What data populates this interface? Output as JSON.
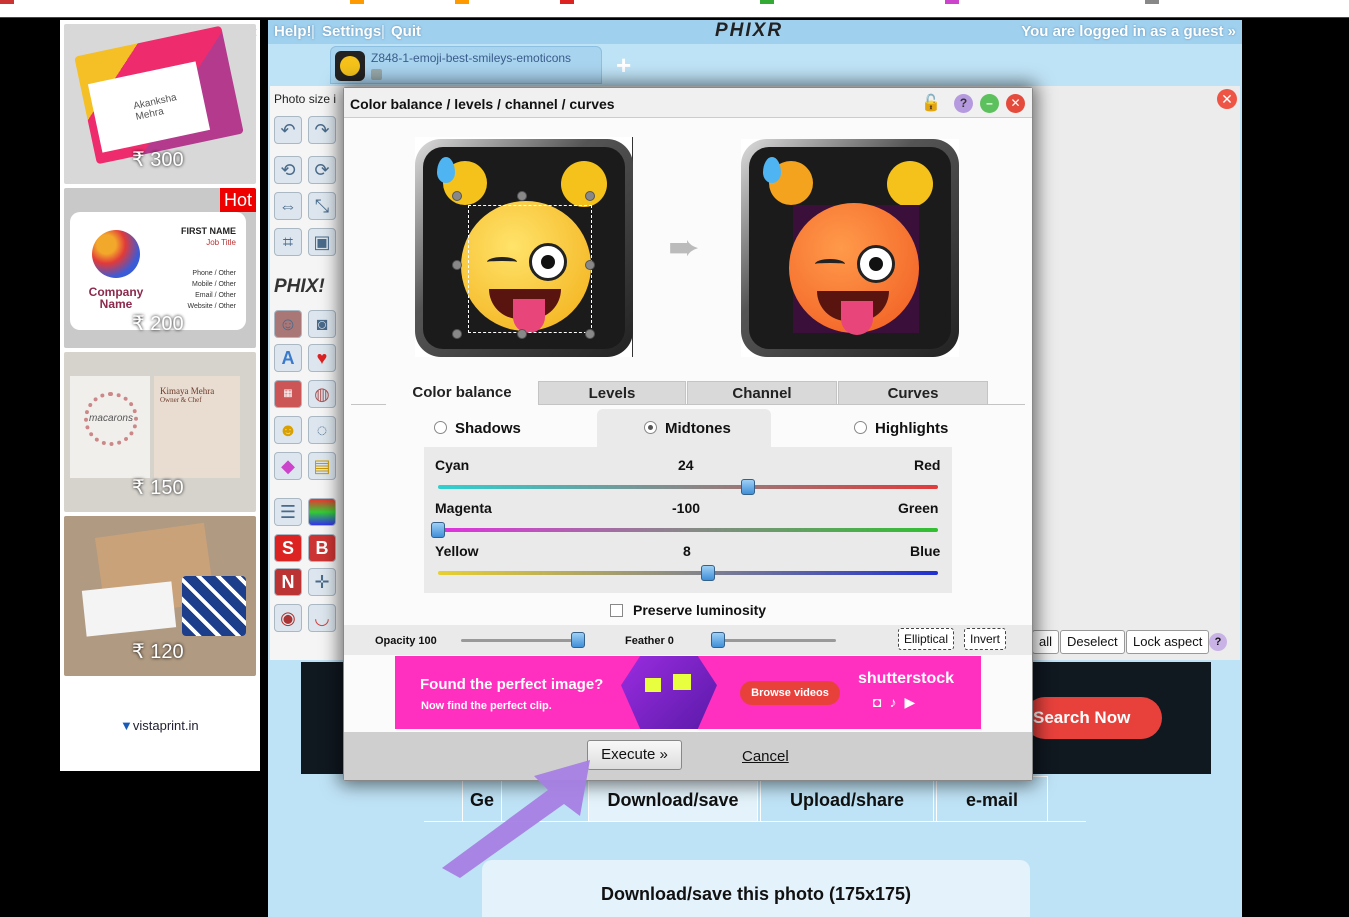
{
  "menu": {
    "help": "Help!",
    "settings": "Settings",
    "quit": "Quit",
    "separator": "|",
    "logo": "PHIXR",
    "guest_notice": "You are logged in as a guest »"
  },
  "image_tab": {
    "filename": "Z848-1-emoji-best-smileys-emoticons",
    "add_tab": "+"
  },
  "workspace": {
    "photo_size_label": "Photo size i",
    "phix_label": "PHIX!"
  },
  "dialog": {
    "title": "Color balance / levels / channel / curves",
    "tabs": [
      "Color balance",
      "Levels",
      "Channel",
      "Curves"
    ],
    "tones": [
      "Shadows",
      "Midtones",
      "Highlights"
    ],
    "selected_tone": "Midtones",
    "sliders": [
      {
        "left": "Cyan",
        "right": "Red",
        "value": 24,
        "min": -100,
        "max": 100
      },
      {
        "left": "Magenta",
        "right": "Green",
        "value": -100,
        "min": -100,
        "max": 100
      },
      {
        "left": "Yellow",
        "right": "Blue",
        "value": 8,
        "min": -100,
        "max": 100
      }
    ],
    "preserve_luminosity": "Preserve luminosity",
    "opacity_label": "Opacity 100",
    "opacity_value": 100,
    "feather_label": "Feather 0",
    "feather_value": 0,
    "elliptical": "Elliptical",
    "invert": "Invert",
    "execute": "Execute »",
    "cancel": "Cancel"
  },
  "dialog_ad": {
    "headline": "Found the perfect image?",
    "subline": "Now find the perfect clip.",
    "button": "Browse videos",
    "brand": "shutterstock"
  },
  "right_buttons": [
    "all",
    "Deselect",
    "Lock aspect",
    "?"
  ],
  "banner": {
    "search_now": "Search Now"
  },
  "bottom_tabs": [
    "Ge",
    "Download/save",
    "Upload/share",
    "e-mail"
  ],
  "download_title": "Download/save this photo (175x175)",
  "ads": {
    "cards": [
      {
        "price": "₹ 300",
        "name": "Akanksha Mehra"
      },
      {
        "price": "₹ 200",
        "badge": "Hot",
        "name": "FIRST NAME",
        "job": "Job Title",
        "company": "Company Name",
        "lines": [
          "Phone / Other",
          "Mobile / Other",
          "Email / Other",
          "Website / Other"
        ]
      },
      {
        "price": "₹ 150",
        "name": "Kimaya Mehra",
        "job": "Owner & Chef",
        "brand": "macarons"
      },
      {
        "price": "₹ 120"
      }
    ],
    "footer": "vistaprint.in"
  },
  "colors": {
    "menubar": "#9fd0ee",
    "app_bg": "#bfe3f6",
    "banner_pink": "#ff2fc0",
    "search_red": "#e8413c"
  }
}
